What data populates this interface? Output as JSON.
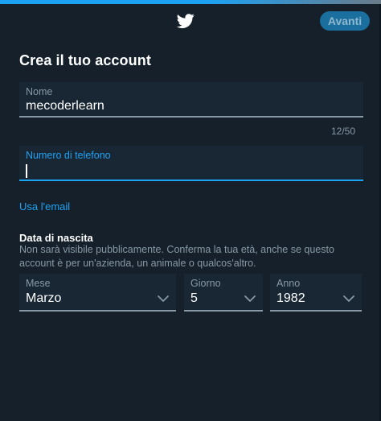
{
  "header": {
    "logo_icon": "twitter-bird-icon",
    "next_label": "Avanti"
  },
  "title": "Crea il tuo account",
  "name_field": {
    "label": "Nome",
    "value": "mecoderlearn",
    "counter": "12/50"
  },
  "phone_field": {
    "label": "Numero di telefono",
    "value": ""
  },
  "use_email_link": "Usa l'email",
  "dob": {
    "title": "Data di nascita",
    "description": "Non sarà visibile pubblicamente. Conferma la tua età, anche se questo account è per un'azienda, un animale o qualcos'altro.",
    "month": {
      "label": "Mese",
      "value": "Marzo"
    },
    "day": {
      "label": "Giorno",
      "value": "5"
    },
    "year": {
      "label": "Anno",
      "value": "1982"
    }
  },
  "colors": {
    "background": "#15202b",
    "accent": "#1da1f2",
    "field_bg": "#192734",
    "muted_text": "#8899a6"
  }
}
